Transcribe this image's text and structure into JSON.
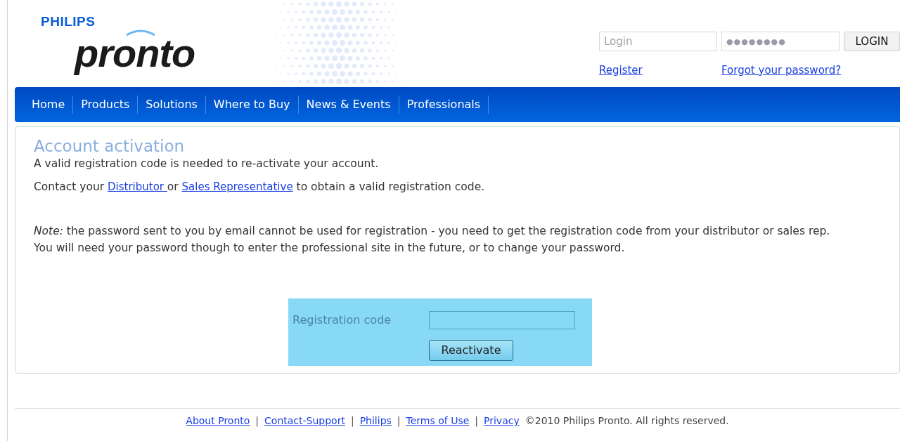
{
  "logo": {
    "brand": "PHILIPS",
    "product": "pronto"
  },
  "login": {
    "login_placeholder": "Login",
    "password_value": "●●●●●●●●",
    "button": "LOGIN",
    "register": "Register",
    "forgot": "Forgot your password?"
  },
  "nav": [
    {
      "label": "Home"
    },
    {
      "label": "Products"
    },
    {
      "label": "Solutions"
    },
    {
      "label": "Where to Buy"
    },
    {
      "label": "News & Events"
    },
    {
      "label": "Professionals"
    }
  ],
  "content": {
    "title": "Account activation",
    "intro": "A valid registration code is needed to re-activate your account.",
    "contact": [
      {
        "kind": "text",
        "text": "Contact your "
      },
      {
        "kind": "link",
        "text": "Distributor "
      },
      {
        "kind": "text",
        "text": "or "
      },
      {
        "kind": "link",
        "text": "Sales Representative"
      },
      {
        "kind": "text",
        "text": " to obtain a valid registration code."
      }
    ],
    "note": [
      "*Note:* the password sent to you by email cannot be used for registration - you need to get the registration code from your distributor or sales rep.",
      "You will need your password though to enter the professional site in the future, or to change your password."
    ],
    "form": {
      "label": "Registration code",
      "button": "Reactivate"
    }
  },
  "footer": {
    "separator": "|",
    "links": [
      "About Pronto",
      "Contact-Support",
      "Philips",
      "Terms of Use",
      "Privacy"
    ],
    "copyright": "©2010 Philips Pronto. All rights reserved."
  }
}
